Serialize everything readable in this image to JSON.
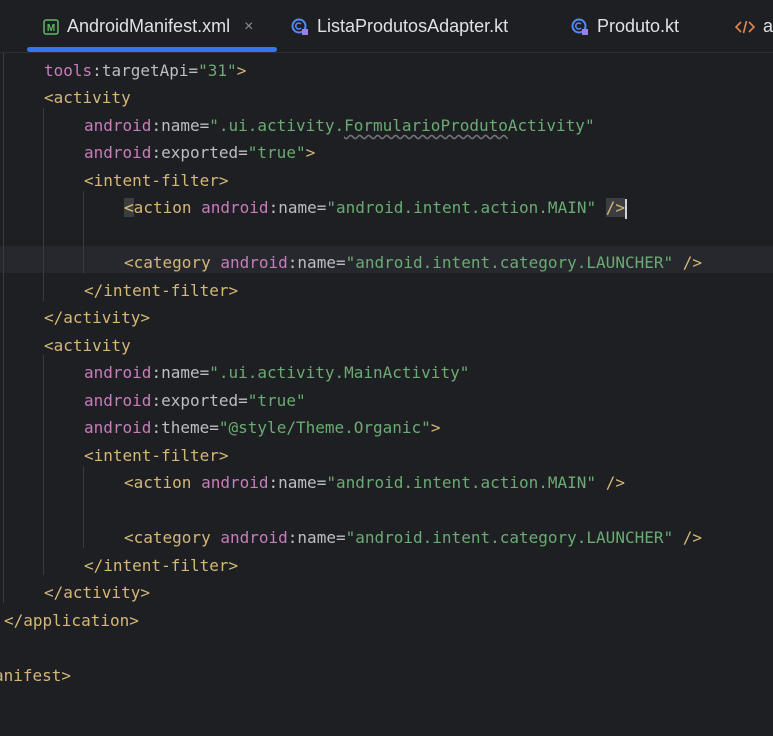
{
  "tabs": [
    {
      "label": "AndroidManifest.xml",
      "icon": "manifest-icon",
      "active": true,
      "close": "×"
    },
    {
      "label": "ListaProdutosAdapter.kt",
      "icon": "kotlin-class-icon",
      "active": false
    },
    {
      "label": "Produto.kt",
      "icon": "kotlin-class-icon",
      "active": false
    },
    {
      "label": "a",
      "icon": "xml-tag-icon",
      "active": false
    }
  ],
  "code": {
    "l1_ns": "tools",
    "l1_attr": "targetApi",
    "l1_val": "\"31\"",
    "activity_open": "<activity",
    "android": "android",
    "name": "name",
    "exported": "exported",
    "theme": "theme",
    "val_form_pre": "\".ui.activity.",
    "val_form_warn": "FormularioProduto",
    "val_form_post": "Activity\"",
    "val_true": "\"true\"",
    "intent_filter_open": "<intent-filter>",
    "action_open": "<action",
    "val_main": "\"android.intent.action.MAIN\"",
    "self_close": "/>",
    "category_open": "<category",
    "val_launcher": "\"android.intent.category.LAUNCHER\"",
    "intent_filter_close": "</intent-filter>",
    "activity_close": "</activity>",
    "val_main_activity": "\".ui.activity.MainActivity\"",
    "val_theme": "\"@style/Theme.Organic\"",
    "application_close": "</application>",
    "manifest_close_visible": "anifest>"
  },
  "colors": {
    "background": "#1e1f22",
    "tag": "#d5b778",
    "namespace": "#c77dbb",
    "string": "#6aab73",
    "text": "#bcbec4",
    "accent": "#3574f0"
  }
}
